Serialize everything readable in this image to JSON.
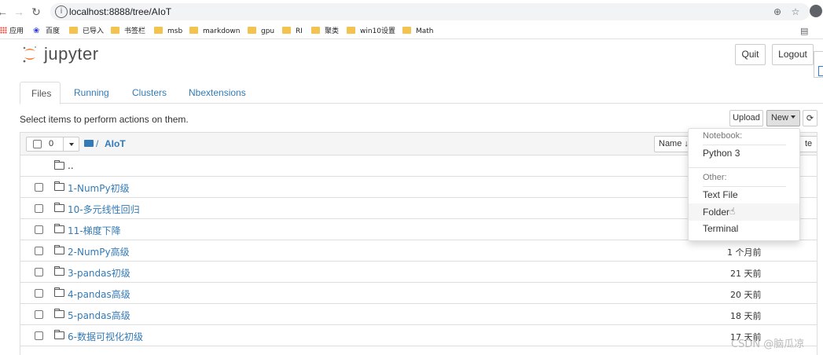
{
  "browser": {
    "url": "localhost:8888/tree/AIoT",
    "bookmarks": [
      {
        "label": "应用",
        "icon": "apps-icon"
      },
      {
        "label": "百度",
        "icon": "baidu-icon"
      },
      {
        "label": "已导入",
        "icon": "folder-icon"
      },
      {
        "label": "书签栏",
        "icon": "folder-icon"
      },
      {
        "label": "msb",
        "icon": "folder-icon"
      },
      {
        "label": "markdown",
        "icon": "folder-icon"
      },
      {
        "label": "gpu",
        "icon": "folder-icon"
      },
      {
        "label": "RI",
        "icon": "folder-icon"
      },
      {
        "label": "聚类",
        "icon": "folder-icon"
      },
      {
        "label": "win10设置",
        "icon": "folder-icon"
      },
      {
        "label": "Math",
        "icon": "folder-icon"
      }
    ]
  },
  "header": {
    "logo_text": "jupyter",
    "quit_label": "Quit",
    "logout_label": "Logout"
  },
  "tabs": [
    {
      "label": "Files",
      "active": true
    },
    {
      "label": "Running"
    },
    {
      "label": "Clusters"
    },
    {
      "label": "Nbextensions"
    }
  ],
  "toolbar": {
    "hint": "Select items to perform actions on them.",
    "upload_label": "Upload",
    "new_label": "New",
    "refresh_icon": "refresh-icon"
  },
  "list_header": {
    "selected_count": "0",
    "breadcrumb_sep": "/",
    "breadcrumb_dir": "AIoT",
    "sort_name_label": "Name",
    "sort_arrow": "↓",
    "last_modified_fragment": "te"
  },
  "rows": [
    {
      "name": "..",
      "time": ""
    },
    {
      "name": "1-NumPy初级",
      "time": ""
    },
    {
      "name": "10-多元线性回归",
      "time": ""
    },
    {
      "name": "11-梯度下降",
      "time": ""
    },
    {
      "name": "2-NumPy高级",
      "time": "1 个月前"
    },
    {
      "name": "3-pandas初级",
      "time": "21 天前"
    },
    {
      "name": "4-pandas高级",
      "time": "20 天前"
    },
    {
      "name": "5-pandas高级",
      "time": "18 天前"
    },
    {
      "name": "6-数据可视化初级",
      "time": "17 天前"
    }
  ],
  "new_menu": {
    "notebook_header": "Notebook:",
    "python_item": "Python 3",
    "other_header": "Other:",
    "text_file_item": "Text File",
    "folder_item": "Folder",
    "terminal_item": "Terminal"
  },
  "watermark": "CSDN @脑瓜凉",
  "colors": {
    "link": "#337ab7",
    "logo_orange": "#f37726"
  }
}
